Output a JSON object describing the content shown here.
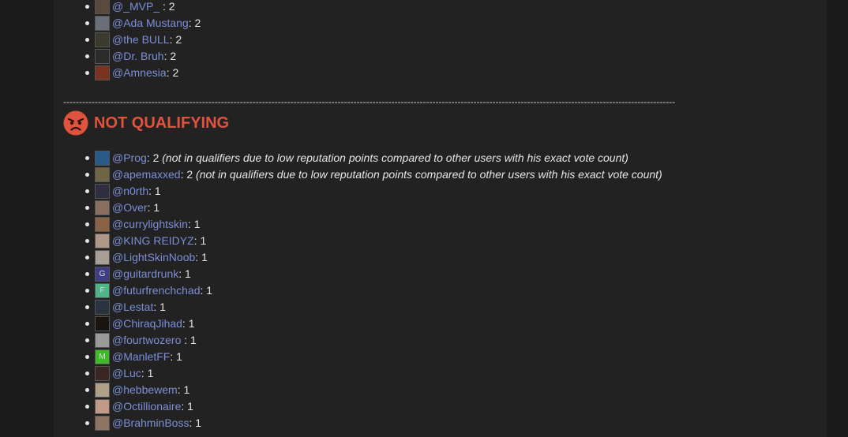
{
  "top_list": [
    {
      "user": "@_MVP_ ",
      "sep": ": ",
      "count": "2",
      "note": "",
      "avatar": {
        "bg": "#5a4a3e",
        "letter": ""
      }
    },
    {
      "user": "@Ada Mustang",
      "sep": ": ",
      "count": "2",
      "note": "",
      "avatar": {
        "bg": "#6a6e78",
        "letter": ""
      }
    },
    {
      "user": "@the BULL",
      "sep": ": ",
      "count": "2",
      "note": "",
      "avatar": {
        "bg": "#3c3a2e",
        "letter": ""
      }
    },
    {
      "user": "@Dr. Bruh",
      "sep": ": ",
      "count": "2",
      "note": "",
      "avatar": {
        "bg": "#2c2c2c",
        "letter": ""
      }
    },
    {
      "user": "@Amnesia",
      "sep": ": ",
      "count": "2",
      "note": "",
      "avatar": {
        "bg": "#7a3320",
        "letter": ""
      }
    }
  ],
  "divider": "--------------------------------------------------------------------------------------------------------------------------------------------------------------------------------------------------",
  "heading": {
    "text": "NOT QUALIFYING",
    "icon": "angry-face-icon",
    "color": "#e0533f"
  },
  "not_qualifying_list": [
    {
      "user": "@Prog",
      "sep": ": ",
      "count": "2",
      "note": " (not in qualifiers due to low reputation points compared to other users with his exact vote count)",
      "avatar": {
        "bg": "#2a5a8a",
        "letter": ""
      }
    },
    {
      "user": "@apemaxxed",
      "sep": ": ",
      "count": "2",
      "note": " (not in qualifiers due to low reputation points compared to other users with his exact vote count)",
      "avatar": {
        "bg": "#6e6446",
        "letter": ""
      }
    },
    {
      "user": "@n0rth",
      "sep": ": ",
      "count": "1",
      "note": "",
      "avatar": {
        "bg": "#2e2e40",
        "letter": ""
      }
    },
    {
      "user": "@Over",
      "sep": ": ",
      "count": "1",
      "note": "",
      "avatar": {
        "bg": "#8a6e60",
        "letter": ""
      }
    },
    {
      "user": "@currylightskin",
      "sep": ": ",
      "count": "1",
      "note": "",
      "avatar": {
        "bg": "#8a6246",
        "letter": ""
      }
    },
    {
      "user": "@KING REIDYZ",
      "sep": ": ",
      "count": "1",
      "note": "",
      "avatar": {
        "bg": "#b09888",
        "letter": ""
      }
    },
    {
      "user": "@LightSkinNoob",
      "sep": ": ",
      "count": "1",
      "note": "",
      "avatar": {
        "bg": "#a89e96",
        "letter": ""
      }
    },
    {
      "user": "@guitardrunk",
      "sep": ": ",
      "count": "1",
      "note": "",
      "avatar": {
        "bg": "#3f3d86",
        "letter": "G"
      }
    },
    {
      "user": "@futurfrenchchad",
      "sep": ": ",
      "count": "1",
      "note": "",
      "avatar": {
        "bg": "#4fb487",
        "letter": "F"
      }
    },
    {
      "user": "@Lestat",
      "sep": ": ",
      "count": "1",
      "note": "",
      "avatar": {
        "bg": "#2a3440",
        "letter": ""
      }
    },
    {
      "user": "@ChiraqJihad",
      "sep": ": ",
      "count": "1",
      "note": "",
      "avatar": {
        "bg": "#1a1410",
        "letter": ""
      }
    },
    {
      "user": "@fourtwozero ",
      "sep": ": ",
      "count": "1",
      "note": "",
      "avatar": {
        "bg": "#9a9a9a",
        "letter": ""
      }
    },
    {
      "user": "@ManletFF",
      "sep": ": ",
      "count": "1",
      "note": "",
      "avatar": {
        "bg": "#3fbb2a",
        "letter": "M"
      }
    },
    {
      "user": "@Luc",
      "sep": ": ",
      "count": "1",
      "note": "",
      "avatar": {
        "bg": "#3a2624",
        "letter": ""
      }
    },
    {
      "user": "@hebbewem",
      "sep": ": ",
      "count": "1",
      "note": "",
      "avatar": {
        "bg": "#b0a088",
        "letter": ""
      }
    },
    {
      "user": "@Octillionaire",
      "sep": ": ",
      "count": "1",
      "note": "",
      "avatar": {
        "bg": "#c09a86",
        "letter": ""
      }
    },
    {
      "user": "@BrahminBoss",
      "sep": ": ",
      "count": "1",
      "note": "",
      "avatar": {
        "bg": "#8e7462",
        "letter": ""
      }
    }
  ],
  "colors": {
    "username_link": "#7c8fd6",
    "page_bg": "#1c1c1c",
    "panel_bg": "#222222",
    "text": "#e6e6e6"
  }
}
